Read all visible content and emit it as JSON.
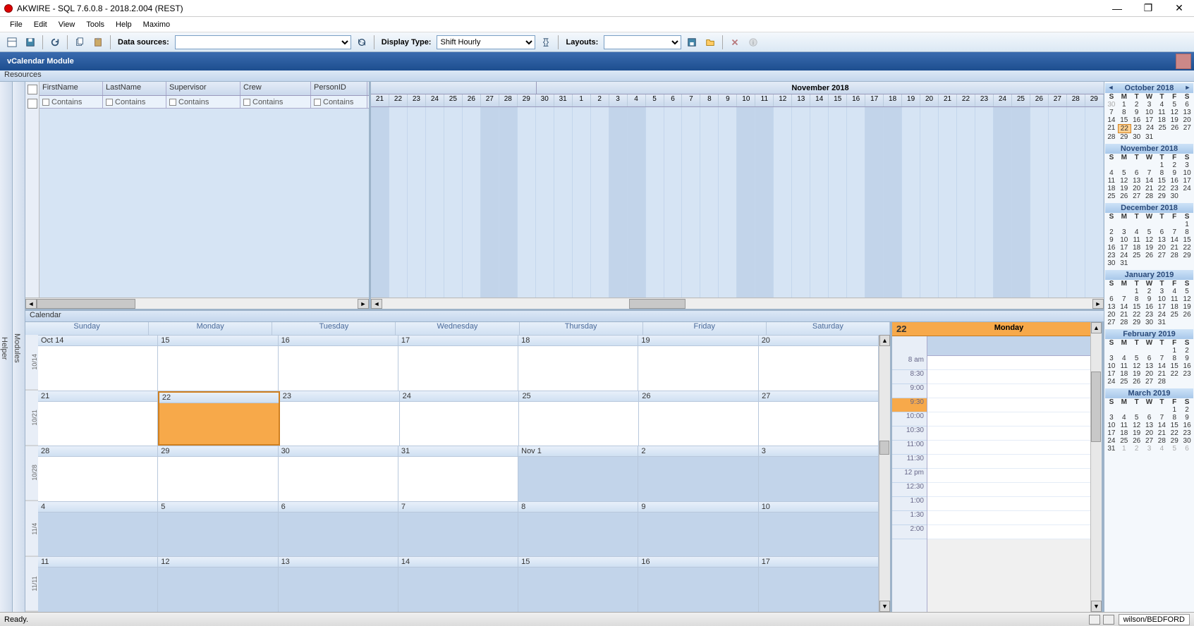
{
  "window": {
    "title": "AKWIRE - SQL 7.6.0.8 - 2018.2.004 (REST)"
  },
  "menu": [
    "File",
    "Edit",
    "View",
    "Tools",
    "Help",
    "Maximo"
  ],
  "toolbar": {
    "data_sources_label": "Data sources:",
    "data_sources_value": "",
    "display_type_label": "Display Type:",
    "display_type_value": "Shift Hourly",
    "layouts_label": "Layouts:",
    "layouts_value": ""
  },
  "module": {
    "title": "vCalendar Module",
    "sub": "Resources"
  },
  "side_tabs": [
    "Helper",
    "Modules"
  ],
  "grid": {
    "columns": [
      "FirstName",
      "LastName",
      "Supervisor",
      "Crew",
      "PersonID"
    ],
    "filter_label": "Contains"
  },
  "timeline": {
    "month": "November 2018",
    "days": [
      "21",
      "22",
      "23",
      "24",
      "25",
      "26",
      "27",
      "28",
      "29",
      "30",
      "31",
      "1",
      "2",
      "3",
      "4",
      "5",
      "6",
      "7",
      "8",
      "9",
      "10",
      "11",
      "12",
      "13",
      "14",
      "15",
      "16",
      "17",
      "18",
      "19",
      "20",
      "21",
      "22",
      "23",
      "24",
      "25",
      "26",
      "27",
      "28",
      "29"
    ],
    "weekend_idx": [
      0,
      6,
      7,
      13,
      14,
      20,
      21,
      27,
      28,
      34,
      35
    ]
  },
  "calendar": {
    "label": "Calendar",
    "dow": [
      "Sunday",
      "Monday",
      "Tuesday",
      "Wednesday",
      "Thursday",
      "Friday",
      "Saturday"
    ],
    "wk_labels": [
      "10/14",
      "10/21",
      "10/28",
      "11/4",
      "11/11"
    ],
    "rows": [
      [
        {
          "l": "Oct 14",
          "o": false
        },
        {
          "l": "15",
          "o": false
        },
        {
          "l": "16",
          "o": false
        },
        {
          "l": "17",
          "o": false
        },
        {
          "l": "18",
          "o": false
        },
        {
          "l": "19",
          "o": false
        },
        {
          "l": "20",
          "o": false
        }
      ],
      [
        {
          "l": "21",
          "o": false
        },
        {
          "l": "22",
          "o": false,
          "sel": true
        },
        {
          "l": "23",
          "o": false
        },
        {
          "l": "24",
          "o": false
        },
        {
          "l": "25",
          "o": false
        },
        {
          "l": "26",
          "o": false
        },
        {
          "l": "27",
          "o": false
        }
      ],
      [
        {
          "l": "28",
          "o": false
        },
        {
          "l": "29",
          "o": false
        },
        {
          "l": "30",
          "o": false
        },
        {
          "l": "31",
          "o": false
        },
        {
          "l": "Nov 1",
          "o": true
        },
        {
          "l": "2",
          "o": true
        },
        {
          "l": "3",
          "o": true
        }
      ],
      [
        {
          "l": "4",
          "o": true
        },
        {
          "l": "5",
          "o": true
        },
        {
          "l": "6",
          "o": true
        },
        {
          "l": "7",
          "o": true
        },
        {
          "l": "8",
          "o": true
        },
        {
          "l": "9",
          "o": true
        },
        {
          "l": "10",
          "o": true
        }
      ],
      [
        {
          "l": "11",
          "o": true
        },
        {
          "l": "12",
          "o": true
        },
        {
          "l": "13",
          "o": true
        },
        {
          "l": "14",
          "o": true
        },
        {
          "l": "15",
          "o": true
        },
        {
          "l": "16",
          "o": true
        },
        {
          "l": "17",
          "o": true
        }
      ]
    ]
  },
  "day_view": {
    "num": "22",
    "name": "Monday",
    "slots": [
      "8 am",
      "8:30",
      "9:00",
      "9:30",
      "10:00",
      "10:30",
      "11:00",
      "11:30",
      "12 pm",
      "12:30",
      "1:00",
      "1:30",
      "2:00"
    ],
    "current_slot": "9:30"
  },
  "mini_cals": [
    {
      "title": "October 2018",
      "nav": true,
      "rows": [
        [
          "30",
          "1",
          "2",
          "3",
          "4",
          "5",
          "6"
        ],
        [
          "7",
          "8",
          "9",
          "10",
          "11",
          "12",
          "13"
        ],
        [
          "14",
          "15",
          "16",
          "17",
          "18",
          "19",
          "20"
        ],
        [
          "21",
          "22",
          "23",
          "24",
          "25",
          "26",
          "27"
        ],
        [
          "28",
          "29",
          "30",
          "31",
          "",
          "",
          ""
        ]
      ],
      "dim": [
        [
          0
        ]
      ],
      "today": [
        3,
        1
      ]
    },
    {
      "title": "November 2018",
      "rows": [
        [
          "",
          "",
          "",
          "",
          "1",
          "2",
          "3"
        ],
        [
          "4",
          "5",
          "6",
          "7",
          "8",
          "9",
          "10"
        ],
        [
          "11",
          "12",
          "13",
          "14",
          "15",
          "16",
          "17"
        ],
        [
          "18",
          "19",
          "20",
          "21",
          "22",
          "23",
          "24"
        ],
        [
          "25",
          "26",
          "27",
          "28",
          "29",
          "30",
          ""
        ]
      ]
    },
    {
      "title": "December 2018",
      "rows": [
        [
          "",
          "",
          "",
          "",
          "",
          "",
          "1"
        ],
        [
          "2",
          "3",
          "4",
          "5",
          "6",
          "7",
          "8"
        ],
        [
          "9",
          "10",
          "11",
          "12",
          "13",
          "14",
          "15"
        ],
        [
          "16",
          "17",
          "18",
          "19",
          "20",
          "21",
          "22"
        ],
        [
          "23",
          "24",
          "25",
          "26",
          "27",
          "28",
          "29"
        ],
        [
          "30",
          "31",
          "",
          "",
          "",
          "",
          ""
        ]
      ]
    },
    {
      "title": "January 2019",
      "rows": [
        [
          "",
          "",
          "1",
          "2",
          "3",
          "4",
          "5"
        ],
        [
          "6",
          "7",
          "8",
          "9",
          "10",
          "11",
          "12"
        ],
        [
          "13",
          "14",
          "15",
          "16",
          "17",
          "18",
          "19"
        ],
        [
          "20",
          "21",
          "22",
          "23",
          "24",
          "25",
          "26"
        ],
        [
          "27",
          "28",
          "29",
          "30",
          "31",
          "",
          ""
        ]
      ]
    },
    {
      "title": "February 2019",
      "rows": [
        [
          "",
          "",
          "",
          "",
          "",
          "1",
          "2"
        ],
        [
          "3",
          "4",
          "5",
          "6",
          "7",
          "8",
          "9"
        ],
        [
          "10",
          "11",
          "12",
          "13",
          "14",
          "15",
          "16"
        ],
        [
          "17",
          "18",
          "19",
          "20",
          "21",
          "22",
          "23"
        ],
        [
          "24",
          "25",
          "26",
          "27",
          "28",
          "",
          ""
        ]
      ]
    },
    {
      "title": "March 2019",
      "rows": [
        [
          "",
          "",
          "",
          "",
          "",
          "1",
          "2"
        ],
        [
          "3",
          "4",
          "5",
          "6",
          "7",
          "8",
          "9"
        ],
        [
          "10",
          "11",
          "12",
          "13",
          "14",
          "15",
          "16"
        ],
        [
          "17",
          "18",
          "19",
          "20",
          "21",
          "22",
          "23"
        ],
        [
          "24",
          "25",
          "26",
          "27",
          "28",
          "29",
          "30"
        ],
        [
          "31",
          "1",
          "2",
          "3",
          "4",
          "5",
          "6"
        ]
      ],
      "dim": [
        [
          5,
          1
        ],
        [
          5,
          2
        ],
        [
          5,
          3
        ],
        [
          5,
          4
        ],
        [
          5,
          5
        ],
        [
          5,
          6
        ]
      ]
    }
  ],
  "mini_dow": [
    "S",
    "M",
    "T",
    "W",
    "T",
    "F",
    "S"
  ],
  "status": {
    "ready": "Ready.",
    "user": "wilson/BEDFORD"
  },
  "colors": {
    "accent": "#f7a94a",
    "primary": "#2a5a9f"
  }
}
